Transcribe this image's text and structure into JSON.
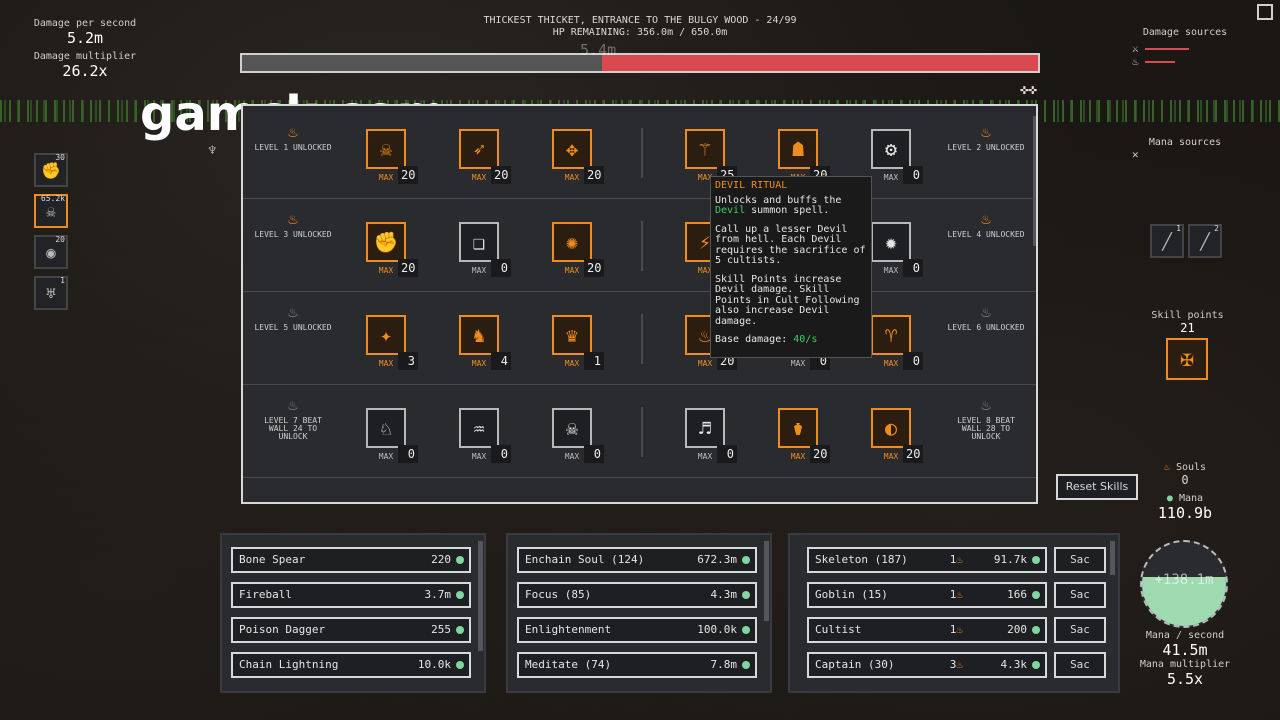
{
  "stats_left": {
    "dps_label": "Damage per second",
    "dps_value": "5.2m",
    "mult_label": "Damage multiplier",
    "mult_value": "26.2x"
  },
  "zone": {
    "title": "THICKEST THICKET, ENTRANCE TO THE BULGY WOOD - 24/99",
    "hp": "HP REMAINING: 356.0m / 650.0m",
    "hp_fraction": 0.548,
    "floating_damage": "5.4m"
  },
  "watermark": "gamck.com",
  "damage_sources_label": "Damage sources",
  "mana_sources_label": "Mana sources",
  "skill_points": {
    "label": "Skill points",
    "value": "21"
  },
  "reset_label": "Reset Skills",
  "souls": {
    "label": "Souls",
    "value": "0"
  },
  "mana": {
    "label": "Mana",
    "value": "110.9b",
    "orb_value": "+138.1m",
    "per_sec_label": "Mana / second",
    "per_sec_value": "41.5m",
    "mult_label": "Mana multiplier",
    "mult_value": "5.5x"
  },
  "side_icons": [
    {
      "name": "fist-icon",
      "count": "30"
    },
    {
      "name": "skull-icon",
      "count": "65.2k"
    },
    {
      "name": "orb-icon",
      "count": "20"
    },
    {
      "name": "demon-icon",
      "count": "1"
    }
  ],
  "tree": {
    "levels": [
      {
        "left": "LEVEL 1 UNLOCKED",
        "right": "LEVEL 2 UNLOCKED",
        "left_on": true,
        "right_on": true
      },
      {
        "left": "LEVEL 3 UNLOCKED",
        "right": "LEVEL 4 UNLOCKED",
        "left_on": true,
        "right_on": true
      },
      {
        "left": "LEVEL 5 UNLOCKED",
        "right": "LEVEL 6 UNLOCKED",
        "left_on": false,
        "right_on": false
      },
      {
        "left": "LEVEL 7 BEAT WALL 24 TO UNLOCK",
        "right": "LEVEL 8 BEAT WALL 28 TO UNLOCK",
        "left_on": false,
        "right_on": false
      }
    ],
    "max_label": "MAX",
    "skills": [
      [
        {
          "icon": "☠",
          "n": "20",
          "maxed": true
        },
        {
          "icon": "➶",
          "n": "20",
          "maxed": true
        },
        {
          "icon": "✥",
          "n": "20",
          "maxed": true
        },
        {
          "icon": "⚚",
          "n": "25",
          "maxed": true
        },
        {
          "icon": "☗",
          "n": "20",
          "maxed": true
        },
        {
          "icon": "⚙",
          "n": "0",
          "maxed": false
        }
      ],
      [
        {
          "icon": "✊",
          "n": "20",
          "maxed": true
        },
        {
          "icon": "❏",
          "n": "0",
          "maxed": false
        },
        {
          "icon": "✺",
          "n": "20",
          "maxed": true
        },
        {
          "icon": "⚡",
          "n": "20",
          "maxed": true
        },
        {
          "icon": "⚘",
          "n": "0",
          "maxed": false
        },
        {
          "icon": "✹",
          "n": "0",
          "maxed": false
        }
      ],
      [
        {
          "icon": "✦",
          "n": "3",
          "maxed": true
        },
        {
          "icon": "♞",
          "n": "4",
          "maxed": true
        },
        {
          "icon": "♛",
          "n": "1",
          "maxed": true
        },
        {
          "icon": "♨",
          "n": "20",
          "maxed": true
        },
        {
          "icon": "☾",
          "n": "0",
          "maxed": false
        },
        {
          "icon": "♈",
          "n": "0",
          "maxed": true
        }
      ],
      [
        {
          "icon": "♘",
          "n": "0",
          "maxed": false
        },
        {
          "icon": "♒",
          "n": "0",
          "maxed": false
        },
        {
          "icon": "☠",
          "n": "0",
          "maxed": false
        },
        {
          "icon": "♬",
          "n": "0",
          "maxed": false
        },
        {
          "icon": "⚱",
          "n": "20",
          "maxed": true
        },
        {
          "icon": "◐",
          "n": "20",
          "maxed": true
        }
      ]
    ]
  },
  "tooltip": {
    "title": "DEVIL RITUAL",
    "line1a": "Unlocks and buffs the",
    "line1b_green": "Devil",
    "line1c": "summon spell.",
    "para2": "Call up a lesser Devil from hell. Each Devil requires the sacrifice of 5 cultists.",
    "para3": "Skill Points increase Devil damage. Skill Points in Cult Following also increase Devil damage.",
    "base_label": "Base damage:",
    "base_value": "40/s"
  },
  "spells": [
    {
      "name": "Bone Spear",
      "cost": "220"
    },
    {
      "name": "Fireball",
      "cost": "3.7m"
    },
    {
      "name": "Poison Dagger",
      "cost": "255"
    },
    {
      "name": "Chain Lightning",
      "cost": "10.0k"
    }
  ],
  "meditations": [
    {
      "name": "Enchain Soul (124)",
      "cost": "672.3m"
    },
    {
      "name": "Focus (85)",
      "cost": "4.3m"
    },
    {
      "name": "Enlightenment",
      "cost": "100.0k"
    },
    {
      "name": "Meditate (74)",
      "cost": "7.8m"
    }
  ],
  "summons": [
    {
      "name": "Skeleton (187)",
      "souls": "1",
      "cost": "91.7k",
      "sac": "Sac"
    },
    {
      "name": "Goblin (15)",
      "souls": "1",
      "cost": "166",
      "sac": "Sac"
    },
    {
      "name": "Cultist",
      "souls": "1",
      "cost": "200",
      "sac": "Sac"
    },
    {
      "name": "Captain (30)",
      "souls": "3",
      "cost": "4.3k",
      "sac": "Sac"
    }
  ],
  "colors": {
    "accent": "#f08c1e",
    "hp_red": "#d9494f",
    "mana_green": "#7fd6a0",
    "panel": "#2a2b2f"
  }
}
